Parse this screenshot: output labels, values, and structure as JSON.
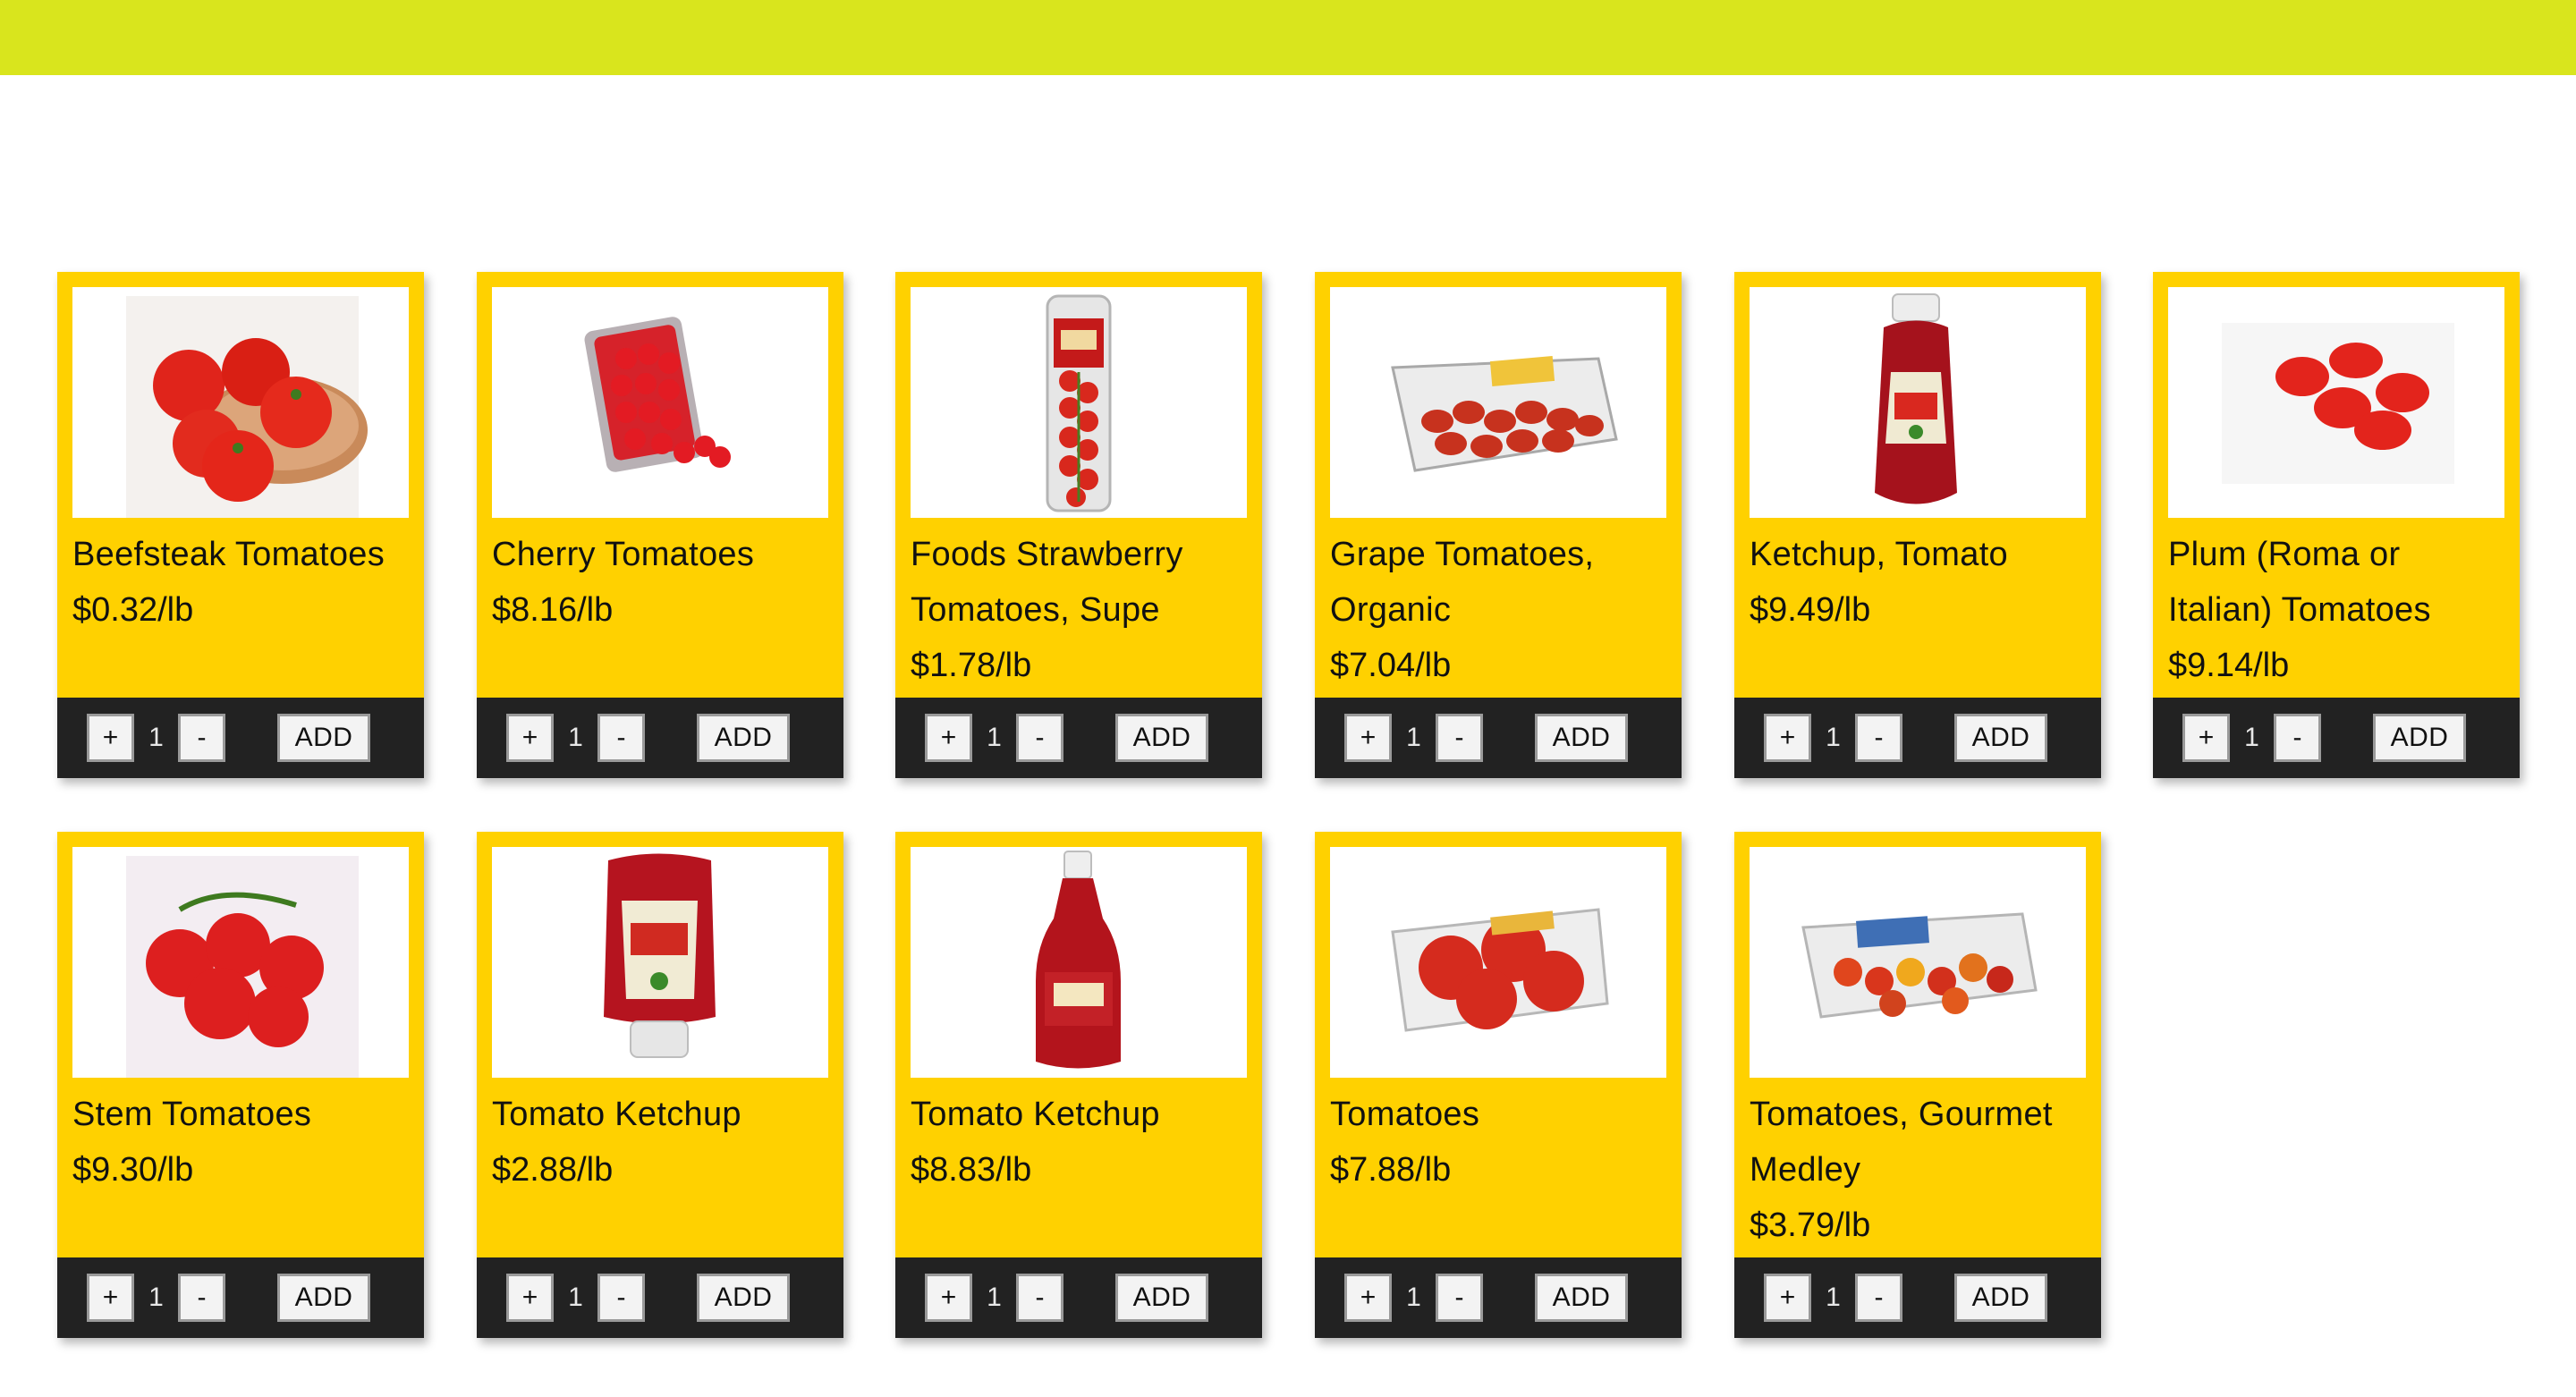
{
  "header": {
    "color": "#d9e51d"
  },
  "theme": {
    "card_color": "#ffd100",
    "control_bar_color": "#222222"
  },
  "controls": {
    "plus_label": "+",
    "minus_label": "-",
    "add_label": "ADD"
  },
  "products": [
    {
      "name": "Beefsteak Tomatoes",
      "price": "$0.32/lb",
      "quantity": "1",
      "image": "beefsteak-tomatoes-image"
    },
    {
      "name": "Cherry Tomatoes",
      "price": "$8.16/lb",
      "quantity": "1",
      "image": "cherry-tomatoes-image"
    },
    {
      "name": "Foods Strawberry Tomatoes, Supe",
      "price": "$1.78/lb",
      "quantity": "1",
      "image": "strawberry-tomatoes-image"
    },
    {
      "name": "Grape Tomatoes, Organic",
      "price": "$7.04/lb",
      "quantity": "1",
      "image": "grape-tomatoes-image"
    },
    {
      "name": "Ketchup, Tomato",
      "price": "$9.49/lb",
      "quantity": "1",
      "image": "ketchup-bottle-image"
    },
    {
      "name": "Plum (Roma or Italian) Tomatoes",
      "price": "$9.14/lb",
      "quantity": "1",
      "image": "plum-tomatoes-image"
    },
    {
      "name": "Stem Tomatoes",
      "price": "$9.30/lb",
      "quantity": "1",
      "image": "stem-tomatoes-image"
    },
    {
      "name": "Tomato Ketchup",
      "price": "$2.88/lb",
      "quantity": "1",
      "image": "ketchup-bottle-image"
    },
    {
      "name": "Tomato Ketchup",
      "price": "$8.83/lb",
      "quantity": "1",
      "image": "ketchup-bottle-image"
    },
    {
      "name": "Tomatoes",
      "price": "$7.88/lb",
      "quantity": "1",
      "image": "tomatoes-pack-image"
    },
    {
      "name": "Tomatoes, Gourmet Medley",
      "price": "$3.79/lb",
      "quantity": "1",
      "image": "gourmet-medley-image"
    }
  ]
}
